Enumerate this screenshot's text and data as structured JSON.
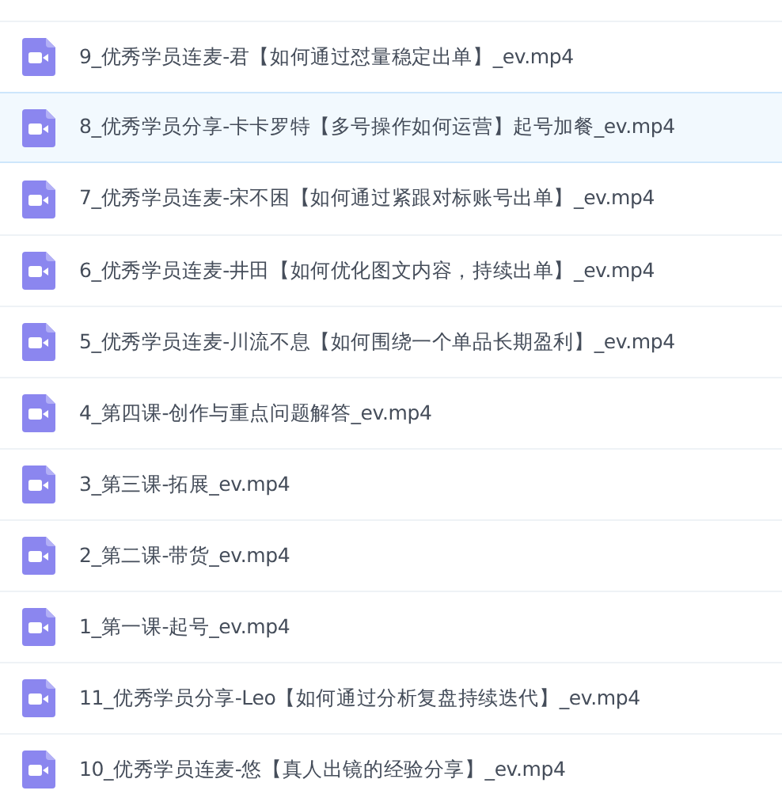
{
  "files": [
    {
      "name": "9_优秀学员连麦-君【如何通过怼量稳定出单】_ev.mp4",
      "selected": false
    },
    {
      "name": "8_优秀学员分享-卡卡罗特【多号操作如何运营】起号加餐_ev.mp4",
      "selected": true
    },
    {
      "name": "7_优秀学员连麦-宋不困【如何通过紧跟对标账号出单】_ev.mp4",
      "selected": false
    },
    {
      "name": "6_优秀学员连麦-井田【如何优化图文内容，持续出单】_ev.mp4",
      "selected": false
    },
    {
      "name": "5_优秀学员连麦-川流不息【如何围绕一个单品长期盈利】_ev.mp4",
      "selected": false
    },
    {
      "name": "4_第四课-创作与重点问题解答_ev.mp4",
      "selected": false
    },
    {
      "name": "3_第三课-拓展_ev.mp4",
      "selected": false
    },
    {
      "name": "2_第二课-带货_ev.mp4",
      "selected": false
    },
    {
      "name": "1_第一课-起号_ev.mp4",
      "selected": false
    },
    {
      "name": "11_优秀学员分享-Leo【如何通过分析复盘持续迭代】_ev.mp4",
      "selected": false
    },
    {
      "name": "10_优秀学员连麦-悠【真人出镜的经验分享】_ev.mp4",
      "selected": false
    }
  ]
}
